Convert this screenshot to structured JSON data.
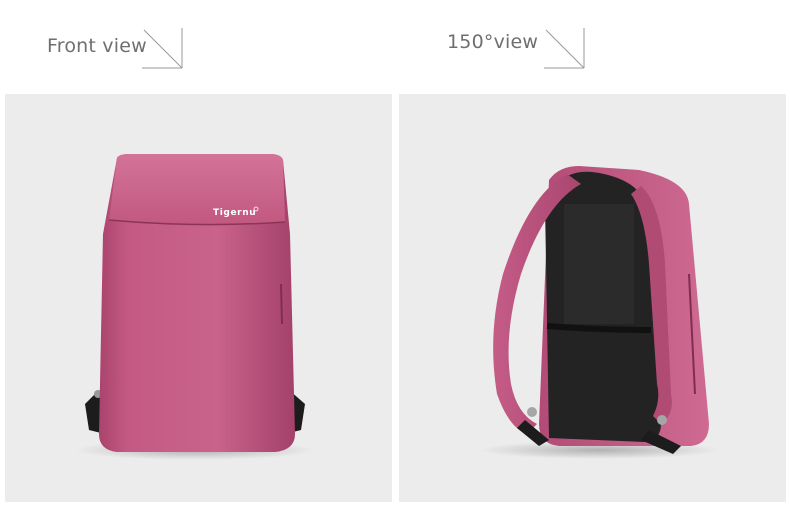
{
  "views": {
    "front_label": "Front view",
    "side_label": "150°view"
  },
  "product": {
    "brand_logo": "Tigernu",
    "color": "#c0557f",
    "strap_color": "#1c1c1c",
    "back_panel_color": "#232323"
  },
  "page": {
    "background": "#ffffff",
    "panel_background": "#ececec",
    "label_color": "#6f6f6f"
  }
}
